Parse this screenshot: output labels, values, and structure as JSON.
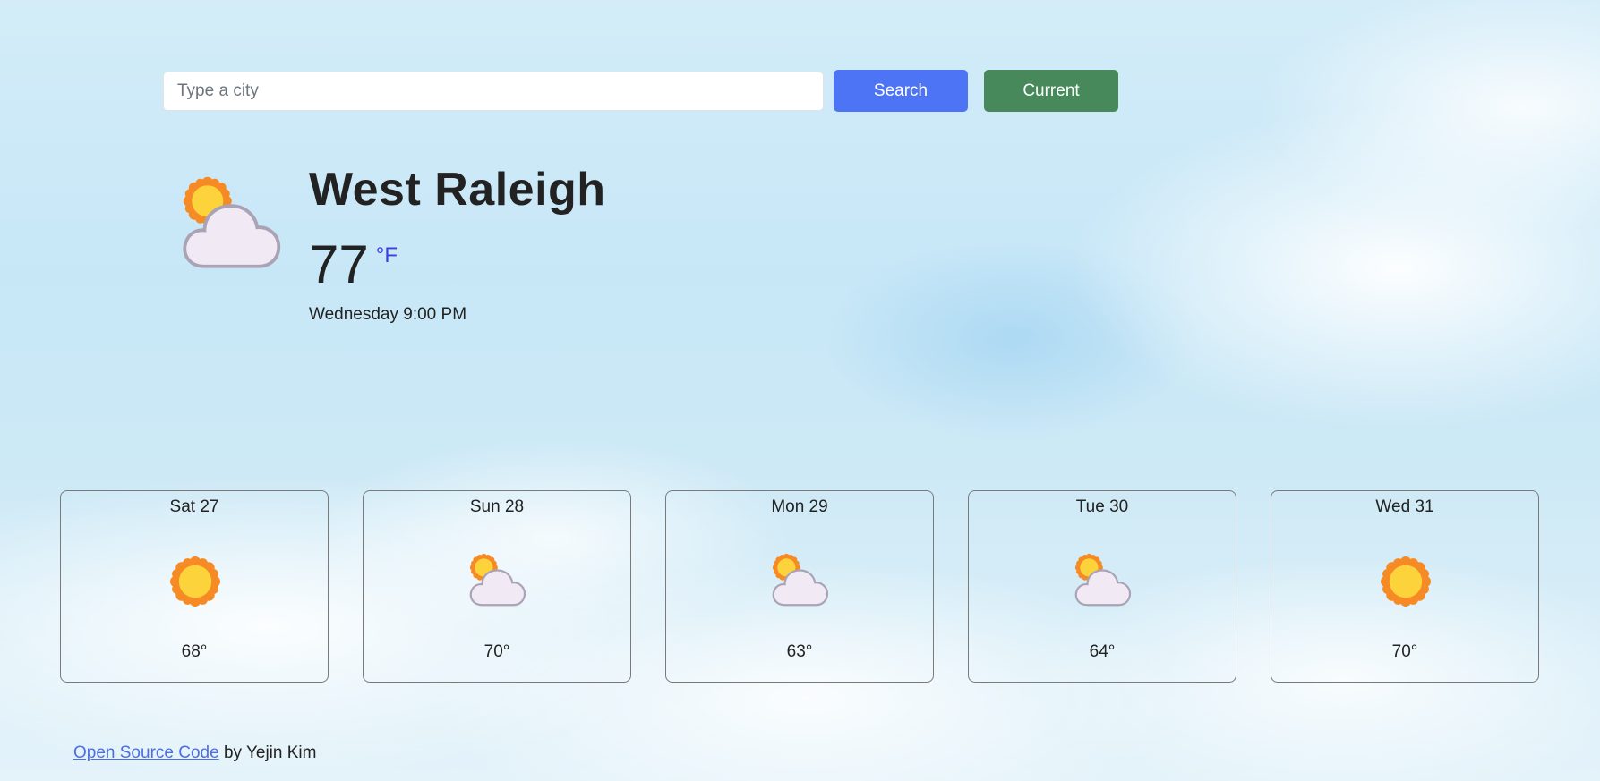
{
  "search": {
    "placeholder": "Type a city",
    "value": "",
    "search_label": "Search",
    "current_label": "Current"
  },
  "current": {
    "city": "West Raleigh",
    "temperature": "77",
    "unit": "°F",
    "datetime": "Wednesday 9:00 PM",
    "icon": "partly-cloudy-icon"
  },
  "forecast": [
    {
      "day": "Sat 27",
      "temp": "68°",
      "icon": "sun-icon"
    },
    {
      "day": "Sun 28",
      "temp": "70°",
      "icon": "partly-cloudy-icon"
    },
    {
      "day": "Mon 29",
      "temp": "63°",
      "icon": "partly-cloudy-icon"
    },
    {
      "day": "Tue 30",
      "temp": "64°",
      "icon": "partly-cloudy-icon"
    },
    {
      "day": "Wed 31",
      "temp": "70°",
      "icon": "sun-icon"
    }
  ],
  "footer": {
    "link_text": "Open Source Code",
    "author_text": "by Yejin Kim"
  },
  "colors": {
    "search_button": "#4d74f4",
    "current_button": "#47895a",
    "unit_link": "#3b3ee6",
    "footer_link": "#4d6ee0"
  }
}
